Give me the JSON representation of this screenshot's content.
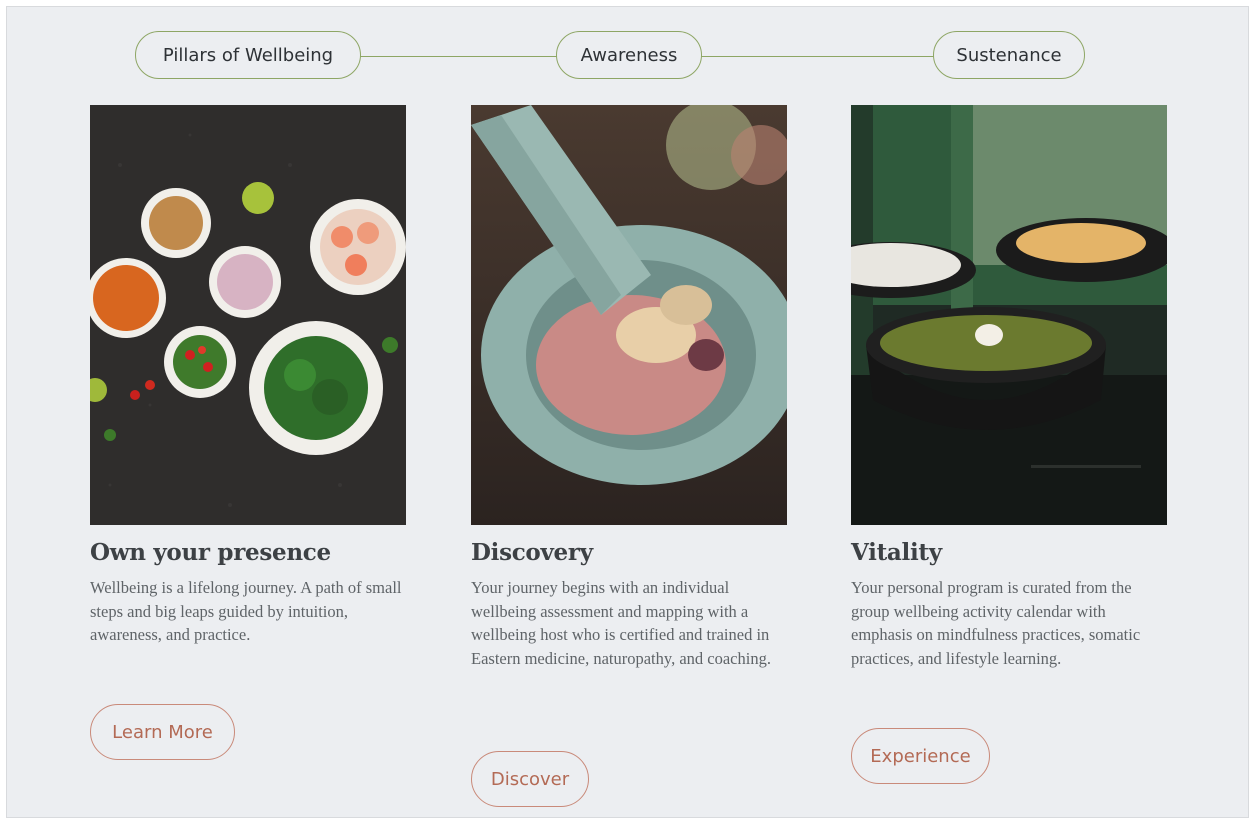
{
  "nav": {
    "pillars_label": "Pillars of Wellbeing",
    "awareness_label": "Awareness",
    "sustenance_label": "Sustenance"
  },
  "cards": [
    {
      "title": "Own your presence",
      "text": "Wellbeing is a lifelong journey. A path of small steps and big leaps guided by intuition, awareness, and practice.",
      "button": "Learn More",
      "image": "spice-bowls-photo"
    },
    {
      "title": "Discovery",
      "text": "Your journey begins with an individual wellbeing assessment and mapping with a wellbeing host who is certified and trained in Eastern medicine, naturopathy, and coaching.",
      "button": "Discover",
      "image": "mortar-and-pestle-photo"
    },
    {
      "title": "Vitality",
      "text": "Your personal program is curated from the group wellbeing activity calendar with emphasis on mindfulness practices, somatic practices, and lifestyle learning.",
      "button": "Experience",
      "image": "soup-bowls-photo"
    }
  ],
  "colors": {
    "background": "#eceef1",
    "nav_accent": "#8ea665",
    "button_accent": "#c98a7a",
    "heading": "#3d4145",
    "body_text": "#5f6468"
  }
}
